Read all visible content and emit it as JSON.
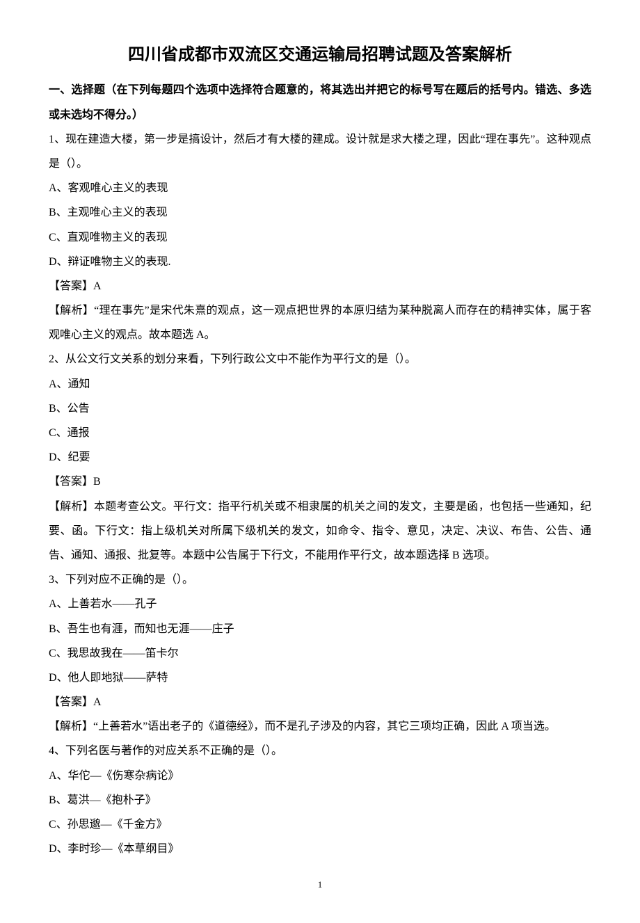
{
  "title": "四川省成都市双流区交通运输局招聘试题及答案解析",
  "section_heading": "一、选择题（在下列每题四个选项中选择符合题意的，将其选出并把它的标号写在题后的括号内。错选、多选或未选均不得分。）",
  "q1": {
    "stem": "1、现在建造大楼，第一步是搞设计，然后才有大楼的建成。设计就是求大楼之理，因此“理在事先”。这种观点是（）。",
    "a": "A、客观唯心主义的表现",
    "b": "B、主观唯心主义的表现",
    "c": "C、直观唯物主义的表现",
    "d": "D、辩证唯物主义的表现.",
    "ans": "【答案】A",
    "exp": "【解析】“理在事先”是宋代朱熹的观点，这一观点把世界的本原归结为某种脱离人而存在的精神实体，属于客观唯心主义的观点。故本题选 A。"
  },
  "q2": {
    "stem": "2、从公文行文关系的划分来看，下列行政公文中不能作为平行文的是（）。",
    "a": "A、通知",
    "b": "B、公告",
    "c": "C、通报",
    "d": "D、纪要",
    "ans": "【答案】B",
    "exp": "【解析】本题考查公文。平行文：指平行机关或不相隶属的机关之间的发文，主要是函，也包括一些通知，纪要、函。下行文：指上级机关对所属下级机关的发文，如命令、指令、意见，决定、决议、布告、公告、通告、通知、通报、批复等。本题中公告属于下行文，不能用作平行文，故本题选择 B 选项。"
  },
  "q3": {
    "stem": "3、下列对应不正确的是（）。",
    "a": "A、上善若水——孔子",
    "b": "B、吾生也有涯，而知也无涯——庄子",
    "c": "C、我思故我在——笛卡尔",
    "d": "D、他人即地狱——萨特",
    "ans": "【答案】A",
    "exp": "【解析】“上善若水”语出老子的《道德经》，而不是孔子涉及的内容，其它三项均正确，因此 A 项当选。"
  },
  "q4": {
    "stem": "4、下列名医与著作的对应关系不正确的是（）。",
    "a": "A、华佗—《伤寒杂病论》",
    "b": "B、葛洪—《抱朴子》",
    "c": "C、孙思邈—《千金方》",
    "d": "D、李时珍—《本草纲目》"
  },
  "pagenum": "1"
}
